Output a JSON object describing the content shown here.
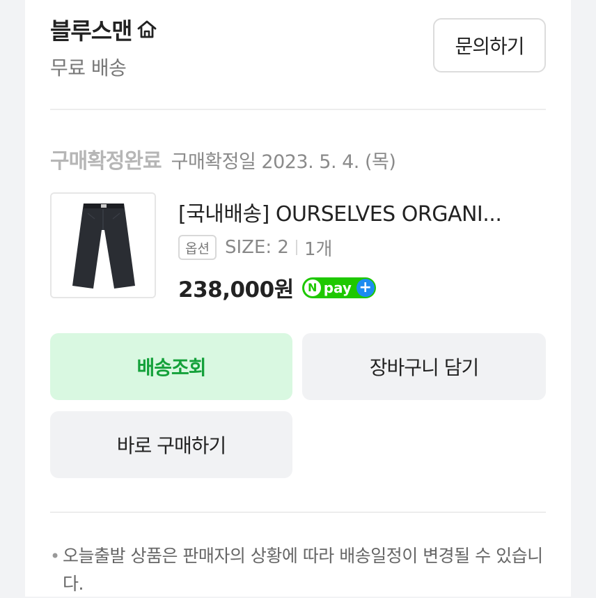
{
  "seller": {
    "name": "블루스맨",
    "shipping": "무료 배송",
    "inquiry_label": "문의하기"
  },
  "order": {
    "status": "구매확정완료",
    "status_date": "구매확정일 2023. 5. 4. (목)"
  },
  "product": {
    "name": "[국내배송] OURSELVES ORGANI...",
    "option_badge": "옵션",
    "option_value": "SIZE: 2",
    "quantity": "1개",
    "price": "238,000원",
    "npay": {
      "n": "N",
      "label": "pay",
      "plus": "+"
    }
  },
  "actions": {
    "track_label": "배송조회",
    "cart_label": "장바구니 담기",
    "buy_label": "바로 구매하기"
  },
  "notice": {
    "bullet": "•",
    "text": "오늘출발 상품은 판매자의 상황에 따라 배송일정이 변경될 수 있습니다."
  },
  "colors": {
    "accent_green": "#14a13a",
    "track_bg": "#d9f8e1",
    "npay_green": "#1ec800",
    "npay_blue": "#1c8cf0"
  },
  "icons": {
    "home": "home-icon",
    "thumbnail": "pants-thumbnail"
  }
}
